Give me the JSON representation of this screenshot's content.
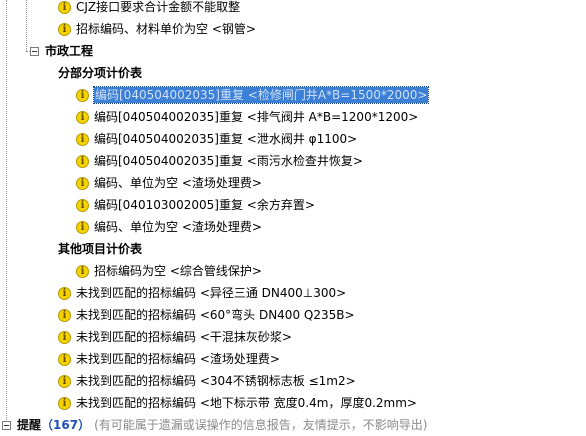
{
  "top_items": [
    "CJZ接口要求合计金额不能取整",
    "招标编码、材料单价为空 <钢管>"
  ],
  "municipal": {
    "title": "市政工程",
    "sections": {
      "subitem": {
        "title": "分部分项计价表",
        "items": [
          "编码[040504002035]重复 <检修闸门井A*B=1500*2000>",
          "编码[040504002035]重复 <排气阀井 A*B=1200*1200>",
          "编码[040504002035]重复 <泄水阀井 φ1100>",
          "编码[040504002035]重复 <雨污水检查井恢复>",
          "编码、单位为空 <渣场处理费>",
          "编码[040103002005]重复 <余方弃置>",
          "编码、单位为空 <渣场处理费>"
        ]
      },
      "other": {
        "title": "其他项目计价表",
        "items": [
          "招标编码为空 <综合管线保护>"
        ]
      }
    },
    "unmatched": [
      "未找到匹配的招标编码 <异径三通 DN400⊥300>",
      "未找到匹配的招标编码 <60°弯头 DN400 Q235B>",
      "未找到匹配的招标编码 <干混抹灰砂浆>",
      "未找到匹配的招标编码 <渣场处理费>",
      "未找到匹配的招标编码 <304不锈钢标志板 ≤1m2>",
      "未找到匹配的招标编码 <地下标示带 宽度0.4m，厚度0.2mm>"
    ]
  },
  "reminder": {
    "label": "提醒",
    "count_open": "（",
    "count": "167",
    "count_close": "）",
    "note": "(有可能属于遗漏或误操作的信息报告，友情提示，不影响导出)"
  },
  "colors": {
    "selection": "#3b7fd6",
    "warning_icon": "#f3d400",
    "count": "#1f4fb8"
  },
  "icons": {
    "item": "info-warning-icon",
    "expander": "collapse-minus-icon"
  }
}
